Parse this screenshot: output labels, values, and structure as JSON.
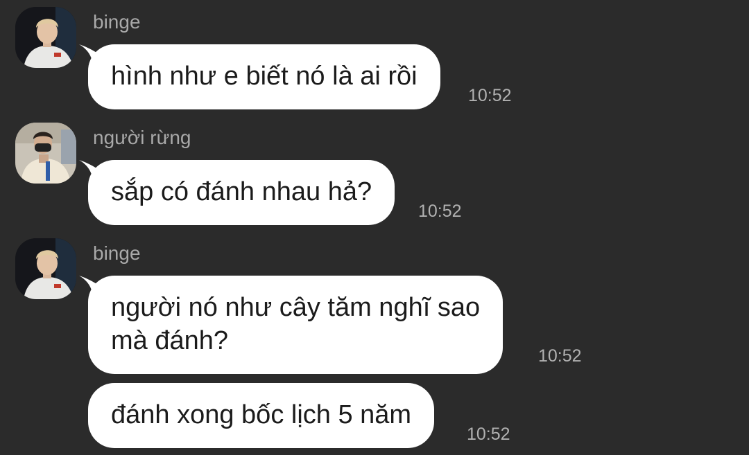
{
  "colors": {
    "background": "#2b2b2b",
    "bubble": "#ffffff",
    "bubble_text": "#1b1b1b",
    "meta_text": "#a9a9a9"
  },
  "messages": [
    {
      "sender": "binge",
      "avatar": "photo-avatar-binge",
      "text": "hình như e biết nó là ai rồi",
      "time": "10:52"
    },
    {
      "sender": "người rừng",
      "avatar": "photo-avatar-nguoi-rung",
      "text": "sắp có đánh nhau hả?",
      "time": "10:52"
    },
    {
      "sender": "binge",
      "avatar": "photo-avatar-binge",
      "text_lines": [
        "người nó như cây tăm nghĩ sao",
        "mà đánh?"
      ],
      "time": "10:52"
    },
    {
      "text": "đánh xong bốc lịch 5 năm",
      "time": "10:52"
    }
  ]
}
